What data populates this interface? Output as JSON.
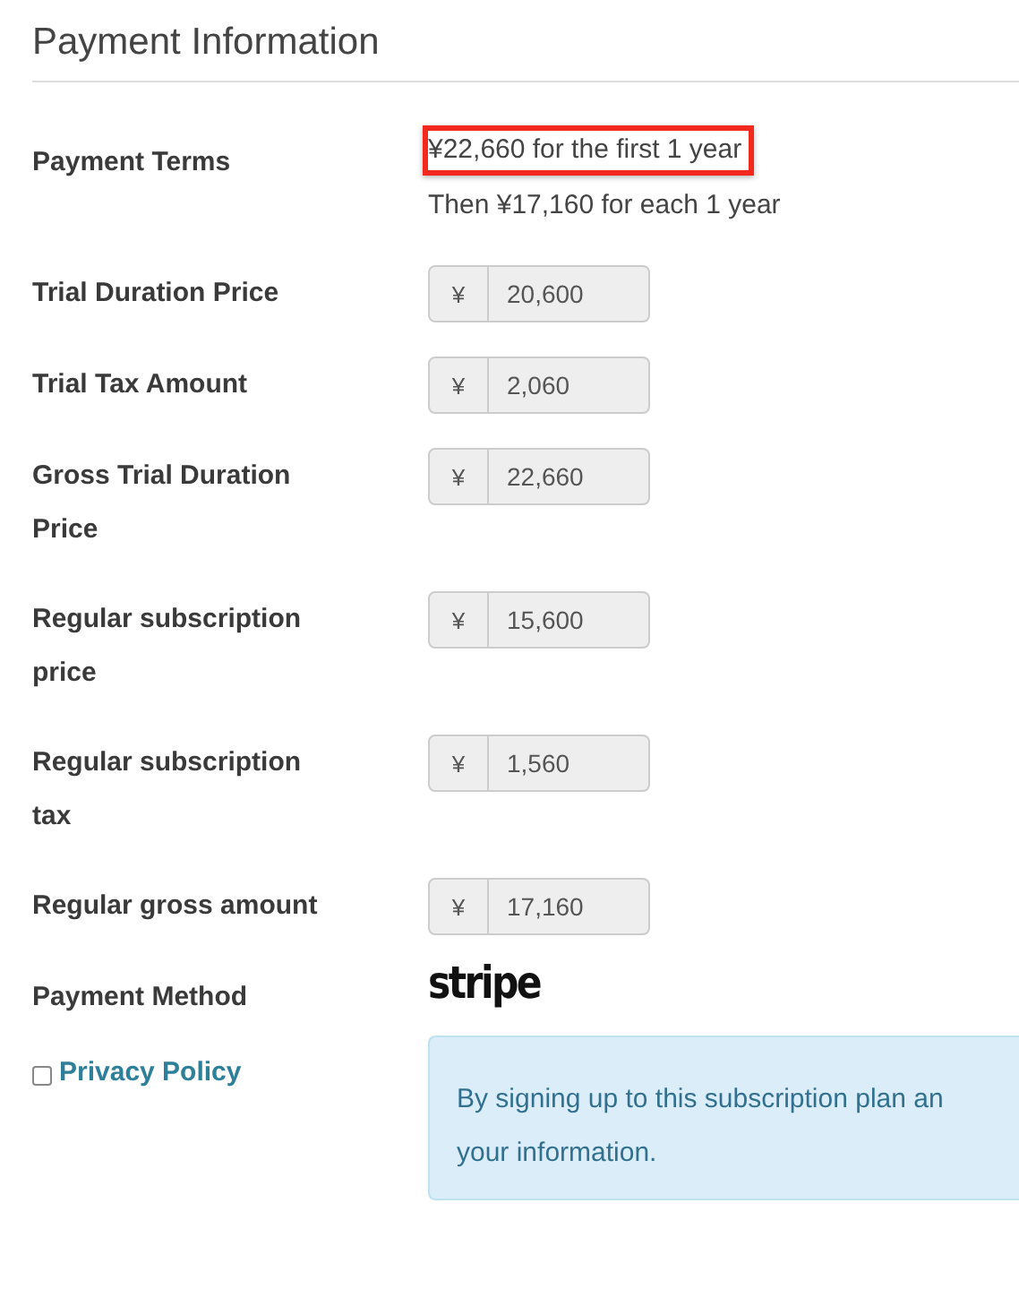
{
  "section": {
    "title": "Payment Information"
  },
  "payment_terms": {
    "label": "Payment Terms",
    "lines": [
      {
        "text": "¥22,660 for the first 1 year",
        "highlighted": true
      },
      {
        "text": "Then ¥17,160 for each 1 year",
        "highlighted": false
      }
    ]
  },
  "fields": [
    {
      "label": "Trial Duration Price",
      "prefix": "¥",
      "value": "20,600"
    },
    {
      "label": "Trial Tax Amount",
      "prefix": "¥",
      "value": "2,060"
    },
    {
      "label": "Gross Trial Duration Price",
      "prefix": "¥",
      "value": "22,660"
    },
    {
      "label": "Regular subscription price",
      "prefix": "¥",
      "value": "15,600"
    },
    {
      "label": "Regular subscription tax",
      "prefix": "¥",
      "value": "1,560"
    },
    {
      "label": "Regular gross amount",
      "prefix": "¥",
      "value": "17,160"
    }
  ],
  "payment_method": {
    "label": "Payment Method",
    "logo": "stripe"
  },
  "privacy": {
    "label": "Privacy Policy",
    "checked": false,
    "notice_lines": [
      "By signing up to this subscription plan an",
      "your information."
    ]
  }
}
